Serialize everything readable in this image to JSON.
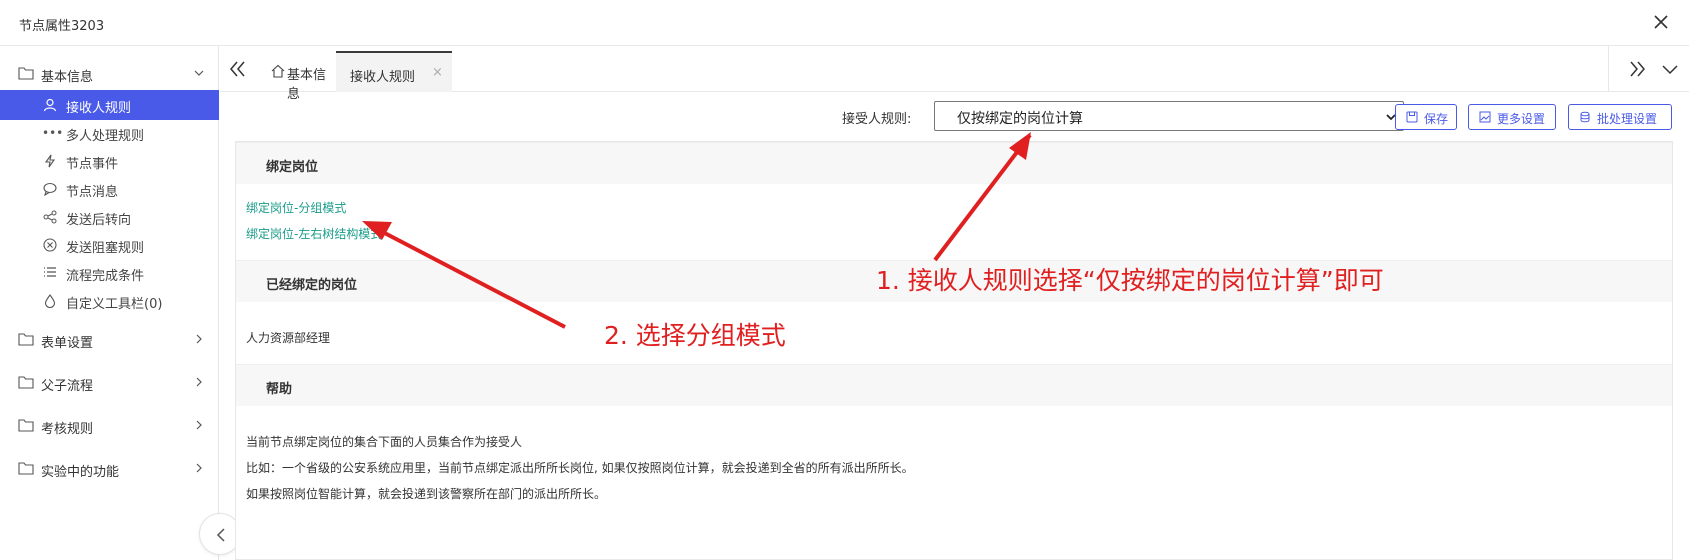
{
  "window": {
    "title": "节点属性3203"
  },
  "sidebar": {
    "groups": [
      {
        "label": "基本信息"
      },
      {
        "label": "表单设置"
      },
      {
        "label": "父子流程"
      },
      {
        "label": "考核规则"
      },
      {
        "label": "实验中的功能"
      }
    ],
    "items": [
      {
        "label": "接收人规则",
        "icon": "user-icon"
      },
      {
        "label": "多人处理规则",
        "icon": "dots-icon"
      },
      {
        "label": "节点事件",
        "icon": "bolt-icon"
      },
      {
        "label": "节点消息",
        "icon": "chat-icon"
      },
      {
        "label": "发送后转向",
        "icon": "share-icon"
      },
      {
        "label": "发送阻塞规则",
        "icon": "block-icon"
      },
      {
        "label": "流程完成条件",
        "icon": "list-icon"
      },
      {
        "label": "自定义工具栏(0)",
        "icon": "drop-icon"
      }
    ]
  },
  "tabs": [
    {
      "label": "基本信息"
    },
    {
      "label": "接收人规则",
      "close": "×"
    }
  ],
  "toolbar": {
    "rule_label": "接受人规则:",
    "rule_value": "仅按绑定的岗位计算",
    "save": "保存",
    "more": "更多设置",
    "batch": "批处理设置"
  },
  "sections": {
    "bind": {
      "title": "绑定岗位",
      "links": [
        "绑定岗位-分组模式",
        "绑定岗位-左右树结构模式"
      ]
    },
    "bound": {
      "title": "已经绑定的岗位",
      "value": "人力资源部经理"
    },
    "help": {
      "title": "帮助",
      "lines": [
        "当前节点绑定岗位的集合下面的人员集合作为接受人",
        "比如：一个省级的公安系统应用里，当前节点绑定派出所所长岗位, 如果仅按照岗位计算，就会投递到全省的所有派出所所长。",
        "如果按照岗位智能计算，就会投递到该警察所在部门的派出所所长。"
      ]
    }
  },
  "annotations": {
    "step1": "1. 接收人规则选择“仅按绑定的岗位计算”即可",
    "step2": "2. 选择分组模式",
    "color": "#e02020"
  },
  "colors": {
    "accent": "#4a5ae8",
    "link": "#1a9d8a"
  }
}
